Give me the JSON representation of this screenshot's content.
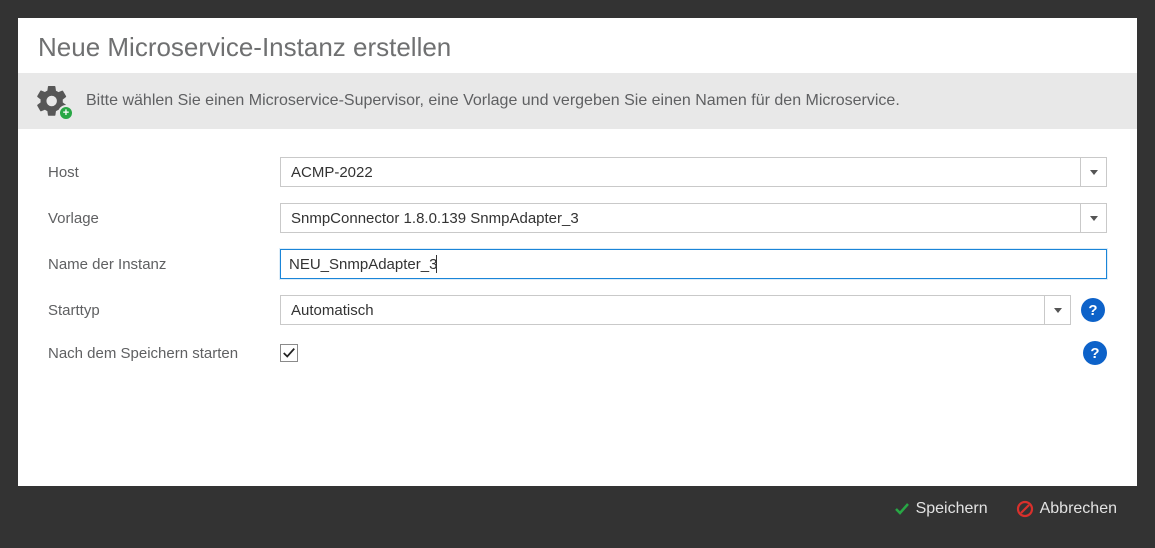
{
  "modal": {
    "title": "Neue Microservice-Instanz erstellen",
    "info_text": "Bitte wählen Sie einen Microservice-Supervisor, eine Vorlage und vergeben Sie einen Namen für den Microservice."
  },
  "form": {
    "host": {
      "label": "Host",
      "value": "ACMP-2022"
    },
    "template": {
      "label": "Vorlage",
      "value": "SnmpConnector 1.8.0.139 SnmpAdapter_3"
    },
    "instance_name": {
      "label": "Name der Instanz",
      "value": "NEU_SnmpAdapter_3"
    },
    "start_type": {
      "label": "Starttyp",
      "value": "Automatisch"
    },
    "start_after_save": {
      "label": "Nach dem Speichern starten",
      "checked": true
    }
  },
  "footer": {
    "save_label": "Speichern",
    "cancel_label": "Abbrechen"
  },
  "icons": {
    "help_glyph": "?",
    "plus_glyph": "+"
  }
}
